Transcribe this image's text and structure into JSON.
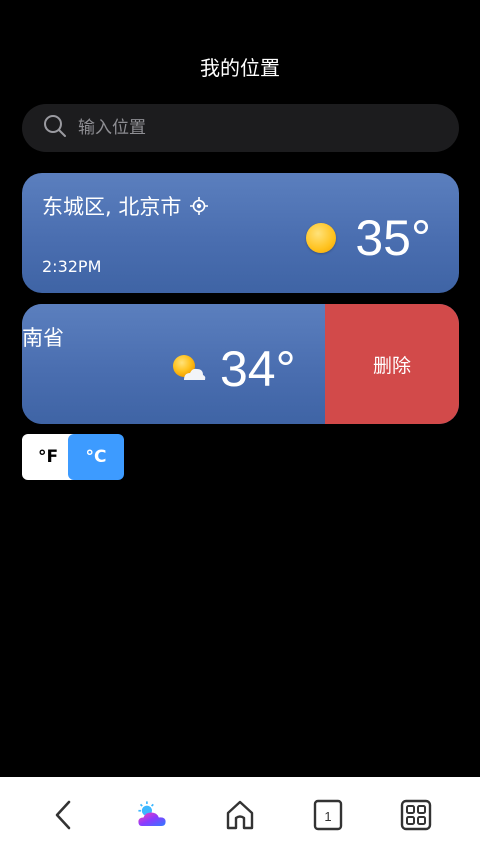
{
  "header": {
    "title": "我的位置"
  },
  "search": {
    "placeholder": "输入位置",
    "icon": "search-icon"
  },
  "locations": [
    {
      "city": "东城区, 北京市",
      "time": "2:32PM",
      "temp": "35°",
      "icon": "sun-icon",
      "current_location": true
    },
    {
      "city": "南省",
      "temp": "34°",
      "icon": "partly-cloudy-icon",
      "delete_label": "删除"
    }
  ],
  "units": {
    "fahrenheit": "°F",
    "celsius": "°C",
    "selected": "°C"
  },
  "colors": {
    "accent": "#3d9bff",
    "delete": "#d24a4a",
    "card": "#4a6eb0"
  },
  "navbar": {
    "icons": [
      "back-icon",
      "weather-app-icon",
      "home-icon",
      "tabs-icon",
      "apps-icon"
    ],
    "tab_count": "1"
  }
}
